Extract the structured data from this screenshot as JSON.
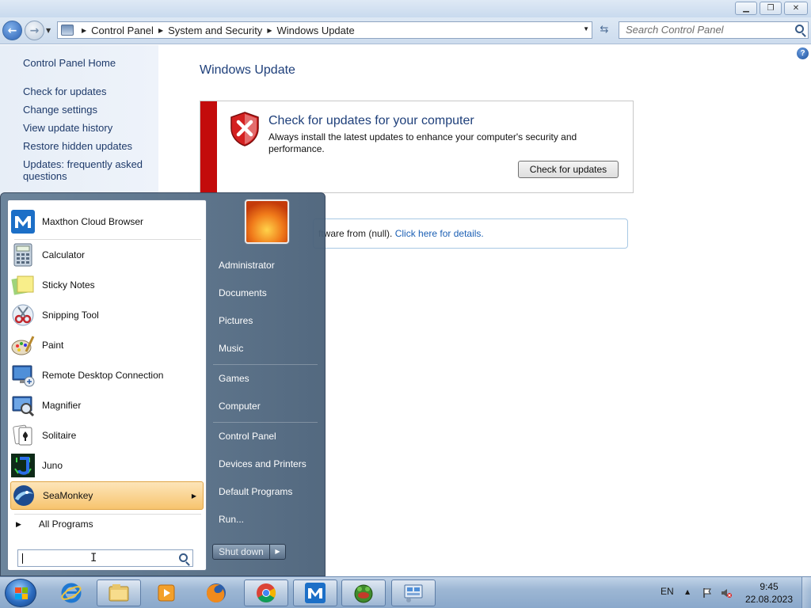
{
  "window": {
    "buttons": [
      "minimize",
      "maximize",
      "close"
    ]
  },
  "navigation": {
    "breadcrumbs": [
      "Control Panel",
      "System and Security",
      "Windows Update"
    ],
    "search_placeholder": "Search Control Panel"
  },
  "sidebar": {
    "home": "Control Panel Home",
    "links": [
      "Check for updates",
      "Change settings",
      "View update history",
      "Restore hidden updates",
      "Updates: frequently asked questions"
    ]
  },
  "main": {
    "title": "Windows Update",
    "alert": {
      "heading": "Check for updates for your computer",
      "body": "Always install the latest updates to enhance your computer's security and performance.",
      "button": "Check for updates",
      "stripe_color": "#c30b0b"
    },
    "info": {
      "text": "ftware from (null).",
      "link": "Click here for details."
    }
  },
  "start_menu": {
    "pinned": [
      {
        "label": "Maxthon Cloud Browser",
        "icon": "maxthon-icon"
      }
    ],
    "recent": [
      {
        "label": "Calculator",
        "icon": "calculator-icon"
      },
      {
        "label": "Sticky Notes",
        "icon": "sticky-notes-icon"
      },
      {
        "label": "Snipping Tool",
        "icon": "snipping-tool-icon"
      },
      {
        "label": "Paint",
        "icon": "paint-icon"
      },
      {
        "label": "Remote Desktop Connection",
        "icon": "remote-desktop-icon"
      },
      {
        "label": "Magnifier",
        "icon": "magnifier-icon"
      },
      {
        "label": "Solitaire",
        "icon": "solitaire-icon"
      },
      {
        "label": "Juno",
        "icon": "juno-icon"
      },
      {
        "label": "SeaMonkey",
        "icon": "seamonkey-icon"
      }
    ],
    "all_programs": "All Programs",
    "right_items": [
      "Administrator",
      "Documents",
      "Pictures",
      "Music",
      "Games",
      "Computer",
      "Control Panel",
      "Devices and Printers",
      "Default Programs",
      "Run..."
    ],
    "shutdown": "Shut down",
    "highlight_color": "#f7c46e"
  },
  "taskbar": {
    "pinned": [
      "internet-explorer-icon",
      "windows-explorer-icon",
      "media-player-icon",
      "firefox-icon",
      "chrome-icon",
      "maxthon-icon",
      "frog-app-icon",
      "control-panel-icon"
    ],
    "language": "EN",
    "time": "9:45",
    "date": "22.08.2023"
  }
}
